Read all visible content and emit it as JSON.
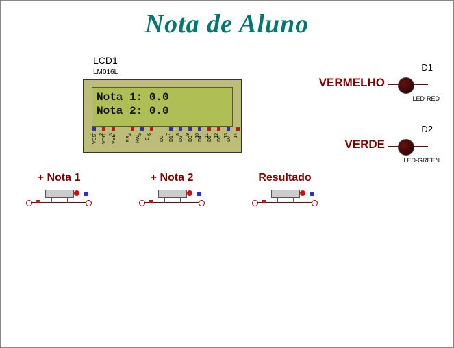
{
  "title": "Nota de Aluno",
  "lcd": {
    "ref": "LCD1",
    "model": "LM016L",
    "line1": "Nota 1: 0.0",
    "line2": "Nota 2: 0.0",
    "pins": [
      "VSS",
      "VDD",
      "VEE",
      "RS",
      "RW",
      "E",
      "D0",
      "D1",
      "D2",
      "D3",
      "D4",
      "D5",
      "D6",
      "D7"
    ],
    "pin_numbers": [
      "1",
      "2",
      "3",
      "4",
      "5",
      "6",
      "7",
      "8",
      "9",
      "10",
      "11",
      "12",
      "13",
      "14"
    ]
  },
  "buttons": {
    "nota1": "+ Nota 1",
    "nota2": "+ Nota 2",
    "result": "Resultado"
  },
  "leds": {
    "d1": {
      "ref": "D1",
      "label": "VERMELHO",
      "type": "LED-RED"
    },
    "d2": {
      "ref": "D2",
      "label": "VERDE",
      "type": "LED-GREEN"
    }
  }
}
